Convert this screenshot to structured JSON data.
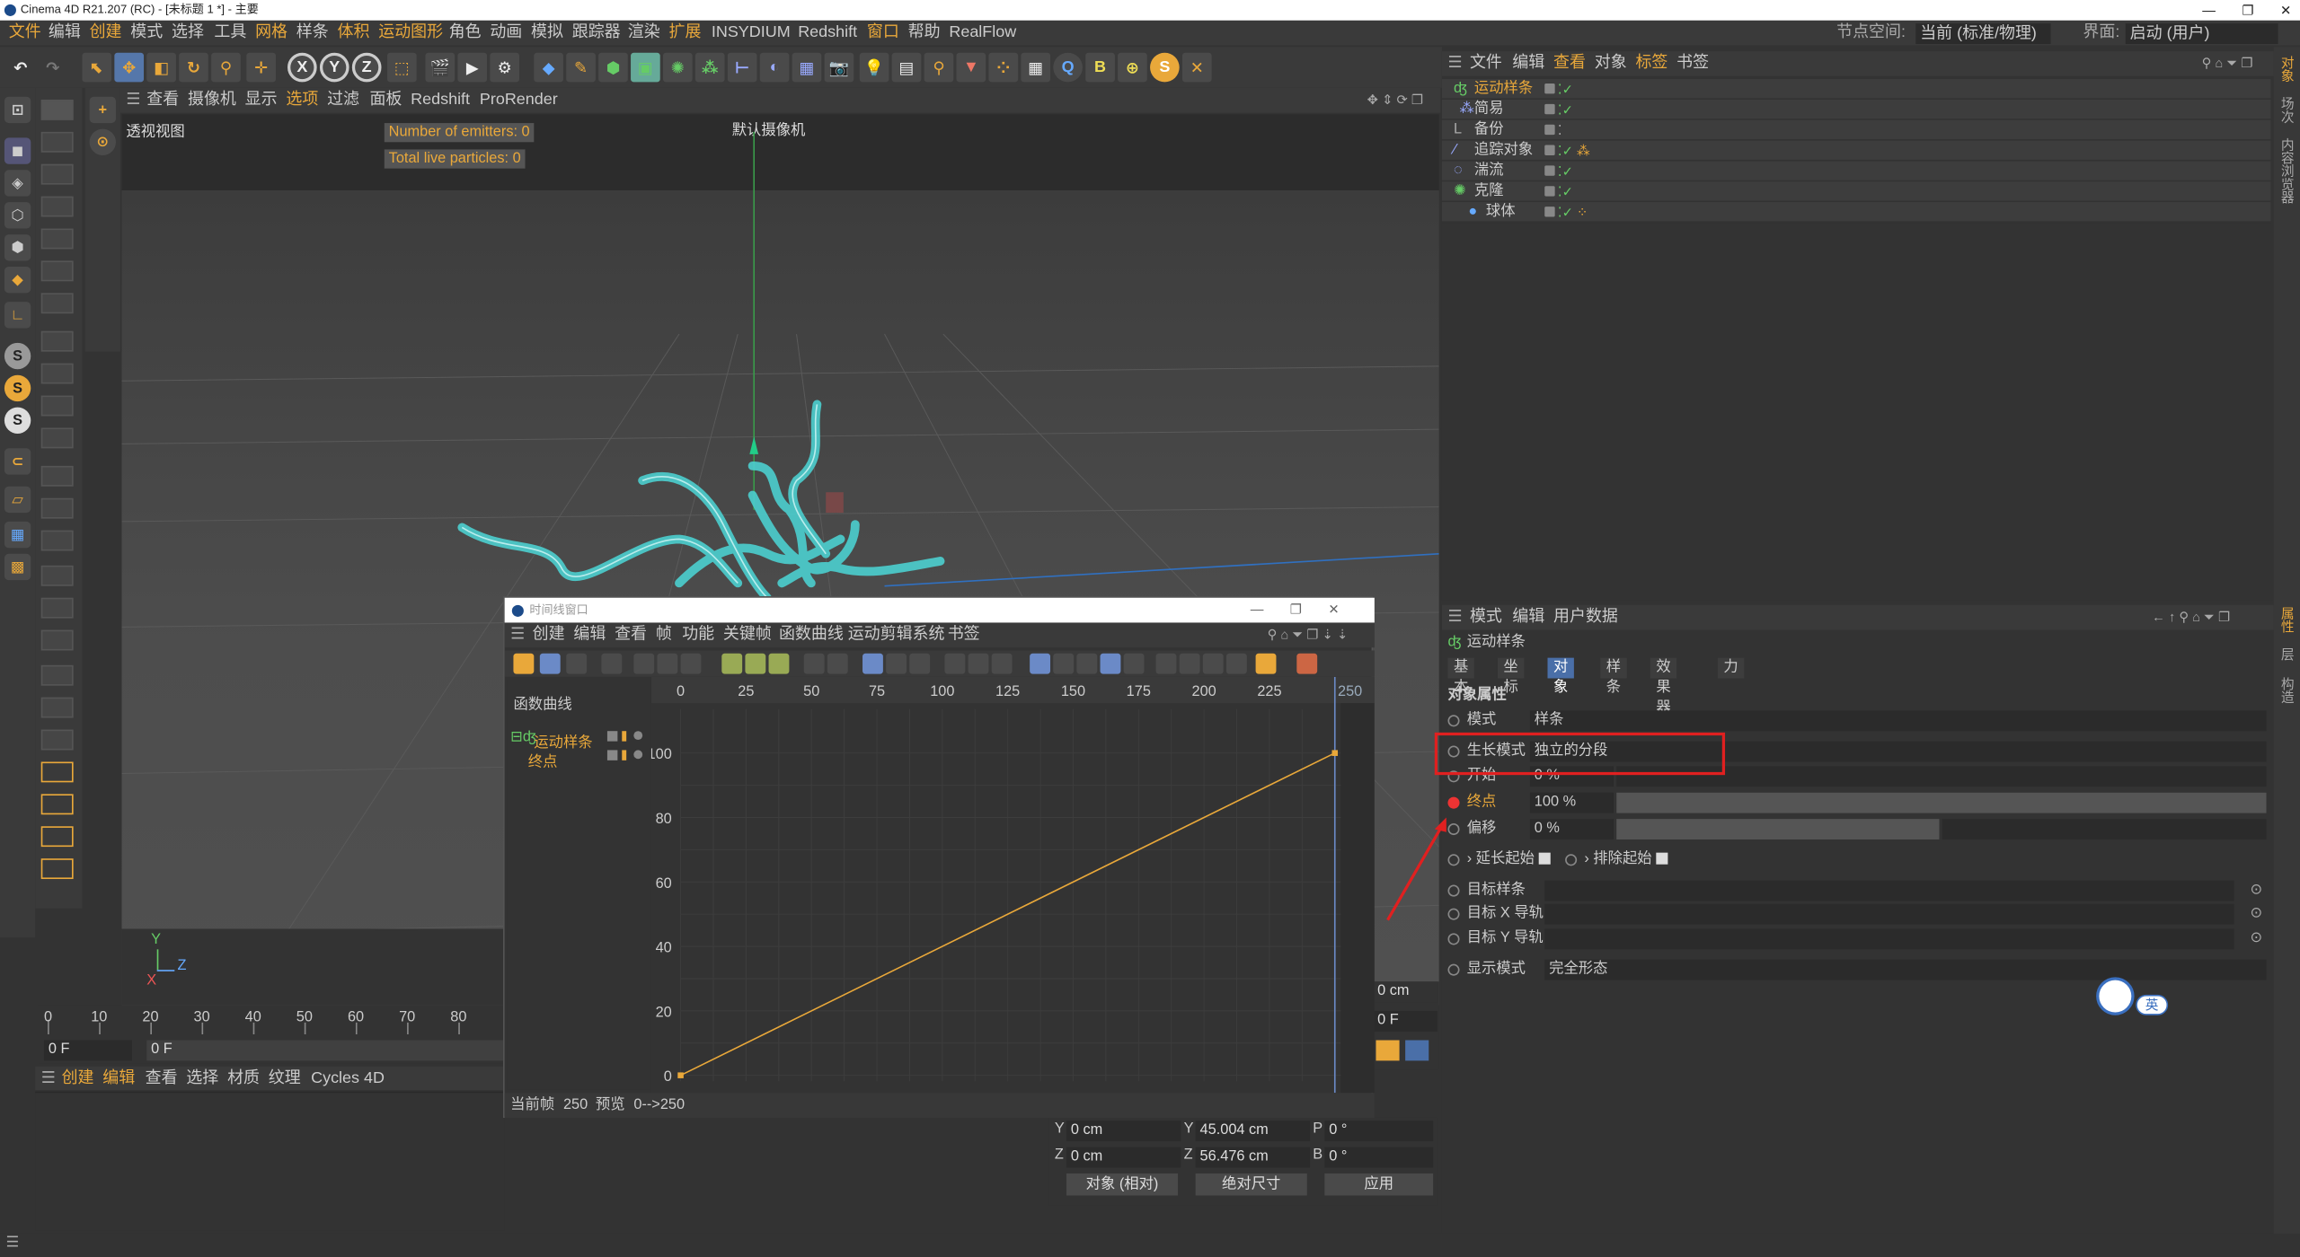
{
  "window": {
    "title": "Cinema 4D R21.207 (RC) - [未标题 1 *] - 主要",
    "controls": [
      "—",
      "❐",
      "✕"
    ]
  },
  "menubar": {
    "items": [
      "文件",
      "编辑",
      "创建",
      "模式",
      "选择",
      "工具",
      "网格",
      "样条",
      "体积",
      "运动图形",
      "角色",
      "动画",
      "模拟",
      "跟踪器",
      "渲染",
      "扩展",
      "INSYDIUM",
      "Redshift",
      "窗口",
      "帮助",
      "RealFlow"
    ],
    "node_space_label": "节点空间:",
    "node_space_value": "当前 (标准/物理)",
    "layout_label": "界面:",
    "layout_value": "启动 (用户)"
  },
  "toolbar": {
    "axis_x": "X",
    "axis_y": "Y",
    "axis_z": "Z"
  },
  "viewport": {
    "menu": [
      "查看",
      "摄像机",
      "显示",
      "选项",
      "过滤",
      "面板",
      "Redshift",
      "ProRender"
    ],
    "view_name": "透视视图",
    "camera": "默认摄像机",
    "hud_emitters": "Number of emitters: 0",
    "hud_particles": "Total live particles: 0",
    "axis_y": "Y",
    "axis_z": "Z",
    "axis_x": "X"
  },
  "timeline": {
    "ticks": [
      "0",
      "10",
      "20",
      "30",
      "40",
      "50",
      "60",
      "70",
      "80"
    ],
    "frame_start": "0 F",
    "frame_current": "0 F"
  },
  "material_bar": {
    "items": [
      "创建",
      "编辑",
      "查看",
      "选择",
      "材质",
      "纹理",
      "Cycles 4D"
    ]
  },
  "object_manager": {
    "menu": [
      "文件",
      "编辑",
      "查看",
      "对象",
      "标签",
      "书签"
    ],
    "objects": [
      {
        "name": "运动样条",
        "active": true,
        "indent": 0
      },
      {
        "name": "简易",
        "active": false,
        "indent": 1
      },
      {
        "name": "备份",
        "active": false,
        "indent": 0
      },
      {
        "name": "追踪对象",
        "active": false,
        "indent": 0
      },
      {
        "name": "湍流",
        "active": false,
        "indent": 0
      },
      {
        "name": "克隆",
        "active": false,
        "indent": 0
      },
      {
        "name": "球体",
        "active": false,
        "indent": 1
      }
    ]
  },
  "side_tabs": [
    "对象",
    "场次",
    "内容浏览器",
    "属性",
    "层",
    "构造"
  ],
  "attributes": {
    "menu": [
      "模式",
      "编辑",
      "用户数据"
    ],
    "object_name": "运动样条",
    "tabs": [
      "基本",
      "坐标",
      "对象",
      "样条",
      "效果器",
      "力"
    ],
    "active_tab": "对象",
    "section": "对象属性",
    "rows": [
      {
        "label": "模式",
        "value": "样条"
      },
      {
        "label": "生长模式",
        "value": "独立的分段"
      },
      {
        "label": "开始",
        "value": "0 %",
        "level": 0.0
      },
      {
        "label": "终点",
        "value": "100 %",
        "level": 1.0
      },
      {
        "label": "偏移",
        "value": "0 %",
        "level": 0.0
      }
    ],
    "extend_start": "延长起始",
    "exclude_start": "排除起始",
    "target_spline": "目标样条",
    "target_x": "目标 X 导轨",
    "target_y": "目标 Y 导轨",
    "display_mode_label": "显示模式",
    "display_mode_value": "完全形态",
    "ime_label": "英"
  },
  "coordinates": {
    "y_pos": "0 cm",
    "y_size": "45.004 cm",
    "p_rot": "0 °",
    "z_pos": "0 cm",
    "z_size": "56.476 cm",
    "b_rot": "0 °",
    "mode": "对象 (相对)",
    "size_mode": "绝对尺寸",
    "apply": "应用",
    "right_val": "0 cm",
    "right_frame": "0 F"
  },
  "timeline_window": {
    "title": "时间线窗口",
    "menu": [
      "创建",
      "编辑",
      "查看",
      "帧",
      "功能",
      "关键帧",
      "函数曲线",
      "运动剪辑系统",
      "书签"
    ],
    "left_title": "函数曲线",
    "tracks": [
      "运动样条",
      "终点"
    ],
    "x_ticks": [
      "0",
      "25",
      "50",
      "75",
      "100",
      "125",
      "150",
      "175",
      "200",
      "225"
    ],
    "end_frame": "250",
    "y_ticks": [
      "100",
      "80",
      "60",
      "40",
      "20",
      "0"
    ],
    "status_label": "当前帧",
    "status_frame": "250",
    "status_preview": "预览",
    "status_range": "0-->250",
    "curve": {
      "x": [
        0,
        250
      ],
      "y": [
        0,
        100
      ]
    }
  },
  "colors": {
    "accent": "#e9a83a",
    "active_tab": "#4a6fa8",
    "highlight": "#e02020"
  }
}
